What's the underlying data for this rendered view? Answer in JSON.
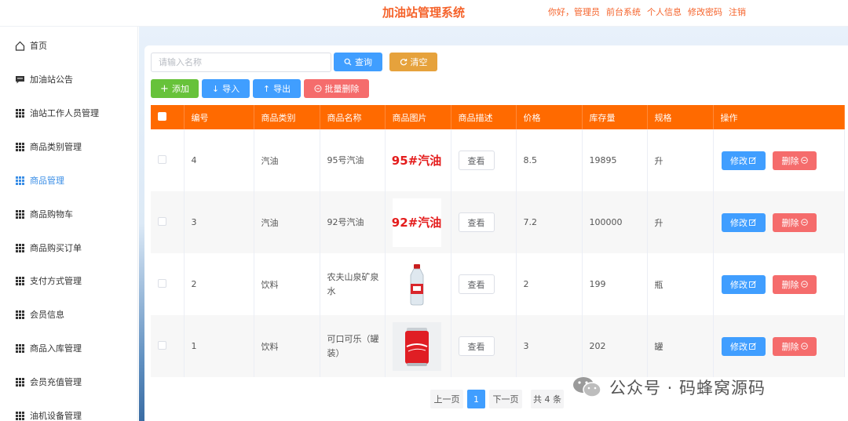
{
  "header": {
    "title": "加油站管理系统",
    "greeting": "你好，管理员",
    "links": [
      "前台系统",
      "个人信息",
      "修改密码",
      "注销"
    ]
  },
  "sidebar": {
    "items": [
      {
        "label": "首页",
        "icon": "home-icon"
      },
      {
        "label": "加油站公告",
        "icon": "message-icon"
      },
      {
        "label": "油站工作人员管理",
        "icon": "grid-icon"
      },
      {
        "label": "商品类别管理",
        "icon": "grid-icon"
      },
      {
        "label": "商品管理",
        "icon": "grid-icon",
        "active": true
      },
      {
        "label": "商品购物车",
        "icon": "grid-icon"
      },
      {
        "label": "商品购买订单",
        "icon": "grid-icon"
      },
      {
        "label": "支付方式管理",
        "icon": "grid-icon"
      },
      {
        "label": "会员信息",
        "icon": "grid-icon"
      },
      {
        "label": "商品入库管理",
        "icon": "grid-icon"
      },
      {
        "label": "会员充值管理",
        "icon": "grid-icon"
      },
      {
        "label": "油机设备管理",
        "icon": "grid-icon"
      }
    ]
  },
  "toolbar": {
    "search_placeholder": "请输入名称",
    "query_label": "查询",
    "clear_label": "清空",
    "add_label": "添加",
    "import_label": "导入",
    "export_label": "导出",
    "batch_delete_label": "批量删除"
  },
  "table": {
    "headers": [
      "编号",
      "商品类别",
      "商品名称",
      "商品图片",
      "商品描述",
      "价格",
      "库存量",
      "规格",
      "操作"
    ],
    "view_label": "查看",
    "edit_label": "修改",
    "delete_label": "删除",
    "rows": [
      {
        "id": "4",
        "category": "汽油",
        "name": "95号汽油",
        "image_text": "95#汽油",
        "price": "8.5",
        "stock": "19895",
        "unit": "升"
      },
      {
        "id": "3",
        "category": "汽油",
        "name": "92号汽油",
        "image_text": "92#汽油",
        "price": "7.2",
        "stock": "100000",
        "unit": "升"
      },
      {
        "id": "2",
        "category": "饮料",
        "name": "农夫山泉矿泉水",
        "image_text": "",
        "price": "2",
        "stock": "199",
        "unit": "瓶"
      },
      {
        "id": "1",
        "category": "饮料",
        "name": "可口可乐（罐装）",
        "image_text": "",
        "price": "3",
        "stock": "202",
        "unit": "罐"
      }
    ]
  },
  "pagination": {
    "prev": "上一页",
    "current": "1",
    "next": "下一页",
    "total": "共 4 条"
  },
  "watermark": {
    "text": "公众号 · 码蜂窝源码"
  },
  "colors": {
    "accent_orange": "#ff6a00",
    "title_orange": "#f5632b",
    "primary_blue": "#409eff",
    "success_green": "#67c23a",
    "warning_orange": "#e6a23c",
    "danger_red": "#f56c6c"
  }
}
